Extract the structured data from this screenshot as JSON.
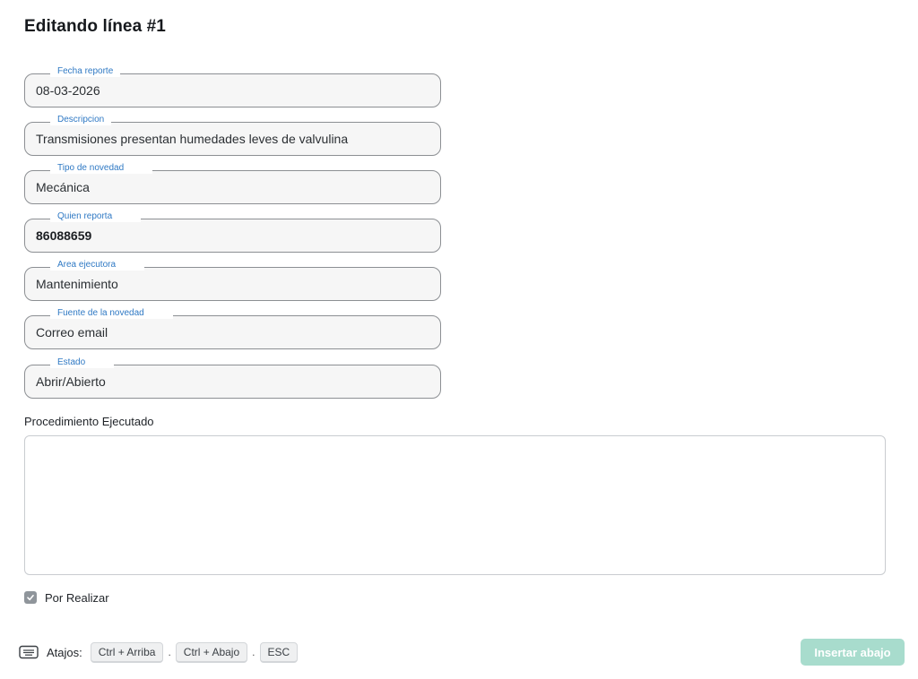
{
  "title": "Editando línea #1",
  "fields": [
    {
      "label": "Fecha reporte",
      "value": "08-03-2026"
    },
    {
      "label": "Descripcion",
      "value": "Transmisiones presentan humedades leves de valvulina"
    },
    {
      "label": "Tipo de novedad",
      "value": "Mecánica"
    },
    {
      "label": "Quien reporta",
      "value": "86088659"
    },
    {
      "label": "Area ejecutora",
      "value": "Mantenimiento"
    },
    {
      "label": "Fuente de la novedad",
      "value": "Correo email"
    },
    {
      "label": "Estado",
      "value": "Abrir/Abierto"
    }
  ],
  "procedure": {
    "label": "Procedimiento Ejecutado",
    "value": ""
  },
  "checkbox": {
    "label": "Por Realizar",
    "checked": true
  },
  "shortcuts": {
    "label": "Atajos:",
    "icon": "keyboard-icon",
    "keys": [
      "Ctrl + Arriba",
      "Ctrl + Abajo",
      "ESC"
    ],
    "separator": "."
  },
  "insert_button": {
    "label": "Insertar abajo"
  },
  "colors": {
    "legend": "#2f79c4",
    "field_bg": "#f6f6f6",
    "field_border": "#8c8f93",
    "button_bg": "#a8dccd",
    "checkbox_bg": "#8f959b"
  }
}
